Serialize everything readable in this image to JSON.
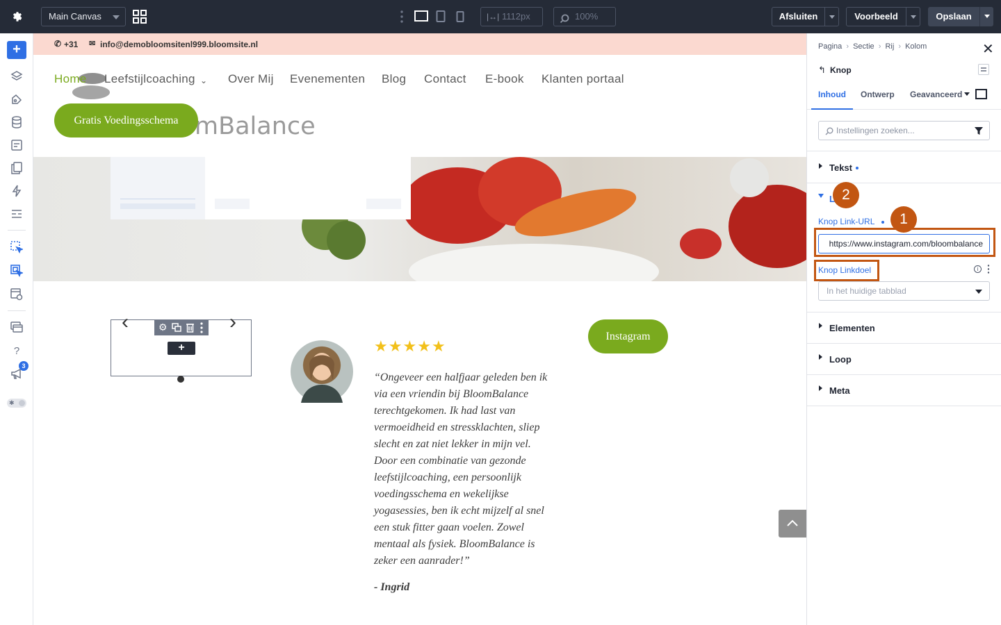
{
  "topbar": {
    "canvas_select": "Main Canvas",
    "width_value": "1112px",
    "zoom_value": "100%",
    "close_label": "Afsluiten",
    "preview_label": "Voorbeeld",
    "save_label": "Opslaan"
  },
  "sidebar": {
    "notification_count": "3"
  },
  "site": {
    "phone": "+31",
    "email": "info@demobloomsitenl999.bloomsite.nl",
    "logo_text": "mBalance",
    "nav": [
      "Home",
      "Leefstijlcoaching",
      "Over Mij",
      "Evenementen",
      "Blog",
      "Contact",
      "E-book",
      "Klanten portaal"
    ],
    "cta_label": "Gratis Voedingsschema",
    "instagram_label": "Instagram",
    "testimonial": {
      "stars": 5,
      "quote": "“Ongeveer een halfjaar geleden ben ik via een vriendin bij BloomBalance terechtgekomen. Ik had last van vermoeidheid en stressklachten, sliep slecht en zat niet lekker in mijn vel. Door een combinatie van gezonde leefstijlcoaching, een persoonlijk voedingsschema en wekelijkse yogasessies, ben ik echt mijzelf al snel een stuk fitter gaan voelen. Zowel mentaal als fysiek. BloomBalance is zeker een aanrader!”",
      "author": "- Ingrid"
    }
  },
  "panel": {
    "breadcrumb": [
      "Pagina",
      "Sectie",
      "Rij",
      "Kolom"
    ],
    "element_title": "Knop",
    "tabs": [
      "Inhoud",
      "Ontwerp",
      "Geavanceerd"
    ],
    "search_placeholder": "Instellingen zoeken...",
    "sections": {
      "tekst": "Tekst",
      "link": "Link",
      "elementen": "Elementen",
      "loop": "Loop",
      "meta": "Meta"
    },
    "link_url_label": "Knop Link-URL",
    "link_url_value": "https://www.instagram.com/bloombalance",
    "link_target_label": "Knop Linkdoel",
    "link_target_value": "In het huidige tabblad"
  },
  "annotations": [
    "1",
    "2"
  ],
  "colors": {
    "topbar_bg": "#252b37",
    "accent_blue": "#2f6fe4",
    "site_green": "#7aaa1e",
    "annotation_orange": "#c25612",
    "topstrip_pink": "#fbd9d0"
  }
}
